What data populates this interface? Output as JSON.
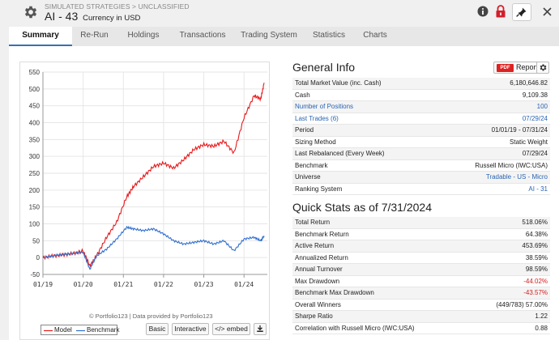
{
  "header": {
    "breadcrumb": "SIMULATED STRATEGIES > UNCLASSIFIED",
    "title": "AI - 43",
    "subtitle": "Currency in USD"
  },
  "tabs": [
    "Summary",
    "Re-Run",
    "Holdings",
    "Transactions",
    "Trading System",
    "Statistics",
    "Charts"
  ],
  "active_tab": "Summary",
  "chart": {
    "credit": "© Portfolio123 | Data provided by Portfolio123",
    "legend": [
      "Model",
      "Benchmark"
    ],
    "buttons": [
      "Basic",
      "Interactive",
      "</> embed"
    ]
  },
  "chart_data": {
    "type": "line",
    "x_ticks": [
      "01/19",
      "01/20",
      "01/21",
      "01/22",
      "01/23",
      "01/24"
    ],
    "ylim": [
      -50,
      550
    ],
    "y_ticks": [
      -50,
      0,
      50,
      100,
      150,
      200,
      250,
      300,
      350,
      400,
      450,
      500,
      550
    ],
    "grid": true,
    "legend_placement": "bottom-left",
    "series": [
      {
        "name": "Model",
        "color": "#e8191b",
        "points": [
          [
            "2019-01",
            0
          ],
          [
            "2019-04",
            5
          ],
          [
            "2019-07",
            8
          ],
          [
            "2019-10",
            12
          ],
          [
            "2020-01",
            20
          ],
          [
            "2020-03",
            -25
          ],
          [
            "2020-05",
            5
          ],
          [
            "2020-08",
            60
          ],
          [
            "2020-11",
            105
          ],
          [
            "2021-02",
            180
          ],
          [
            "2021-04",
            210
          ],
          [
            "2021-07",
            240
          ],
          [
            "2021-10",
            270
          ],
          [
            "2022-01",
            280
          ],
          [
            "2022-04",
            265
          ],
          [
            "2022-07",
            290
          ],
          [
            "2022-10",
            320
          ],
          [
            "2023-01",
            335
          ],
          [
            "2023-04",
            330
          ],
          [
            "2023-07",
            345
          ],
          [
            "2023-10",
            310
          ],
          [
            "2024-01",
            415
          ],
          [
            "2024-04",
            480
          ],
          [
            "2024-06",
            470
          ],
          [
            "2024-07",
            518
          ]
        ]
      },
      {
        "name": "Benchmark",
        "color": "#2f6fd0",
        "points": [
          [
            "2019-01",
            0
          ],
          [
            "2019-04",
            5
          ],
          [
            "2019-07",
            10
          ],
          [
            "2019-10",
            12
          ],
          [
            "2020-01",
            15
          ],
          [
            "2020-03",
            -35
          ],
          [
            "2020-05",
            5
          ],
          [
            "2020-08",
            25
          ],
          [
            "2020-11",
            55
          ],
          [
            "2021-02",
            90
          ],
          [
            "2021-04",
            85
          ],
          [
            "2021-07",
            80
          ],
          [
            "2021-10",
            85
          ],
          [
            "2022-01",
            70
          ],
          [
            "2022-04",
            50
          ],
          [
            "2022-07",
            40
          ],
          [
            "2022-10",
            45
          ],
          [
            "2023-01",
            50
          ],
          [
            "2023-04",
            40
          ],
          [
            "2023-07",
            50
          ],
          [
            "2023-10",
            20
          ],
          [
            "2024-01",
            55
          ],
          [
            "2024-04",
            60
          ],
          [
            "2024-06",
            50
          ],
          [
            "2024-07",
            64
          ]
        ]
      }
    ]
  },
  "general_info": {
    "title": "General Info",
    "report_label": "Report",
    "pdf_label": "PDF",
    "rows": [
      {
        "label": "Total Market Value (inc. Cash)",
        "value": "6,180,646.82"
      },
      {
        "label": "Cash",
        "value": "9,109.38"
      },
      {
        "label": "Number of Positions",
        "value": "100",
        "link": true
      },
      {
        "label": "Last Trades (6)",
        "value": "07/29/24",
        "link": true
      },
      {
        "label": "Period",
        "value": "01/01/19 - 07/31/24"
      },
      {
        "label": "Sizing Method",
        "value": "Static Weight"
      },
      {
        "label": "Last Rebalanced (Every Week)",
        "value": "07/29/24"
      },
      {
        "label": "Benchmark",
        "value": "Russell Micro (IWC:USA)"
      },
      {
        "label": "Universe",
        "value": "Tradable - US - Micro",
        "vlink": true
      },
      {
        "label": "Ranking System",
        "value": "AI - 31",
        "vlink": true
      }
    ]
  },
  "quick_stats": {
    "title": "Quick Stats as of 7/31/2024",
    "rows": [
      {
        "label": "Total Return",
        "value": "518.06%"
      },
      {
        "label": "Benchmark Return",
        "value": "64.38%"
      },
      {
        "label": "Active Return",
        "value": "453.69%"
      },
      {
        "label": "Annualized Return",
        "value": "38.59%"
      },
      {
        "label": "Annual Turnover",
        "value": "98.59%"
      },
      {
        "label": "Max Drawdown",
        "value": "-44.02%",
        "neg": true
      },
      {
        "label": "Benchmark Max Drawdown",
        "value": "-43.57%",
        "neg": true
      },
      {
        "label": "Overall Winners",
        "value": "(449/783) 57.00%"
      },
      {
        "label": "Sharpe Ratio",
        "value": "1.22"
      },
      {
        "label": "Correlation with Russell Micro (IWC:USA)",
        "value": "0.88"
      }
    ]
  }
}
